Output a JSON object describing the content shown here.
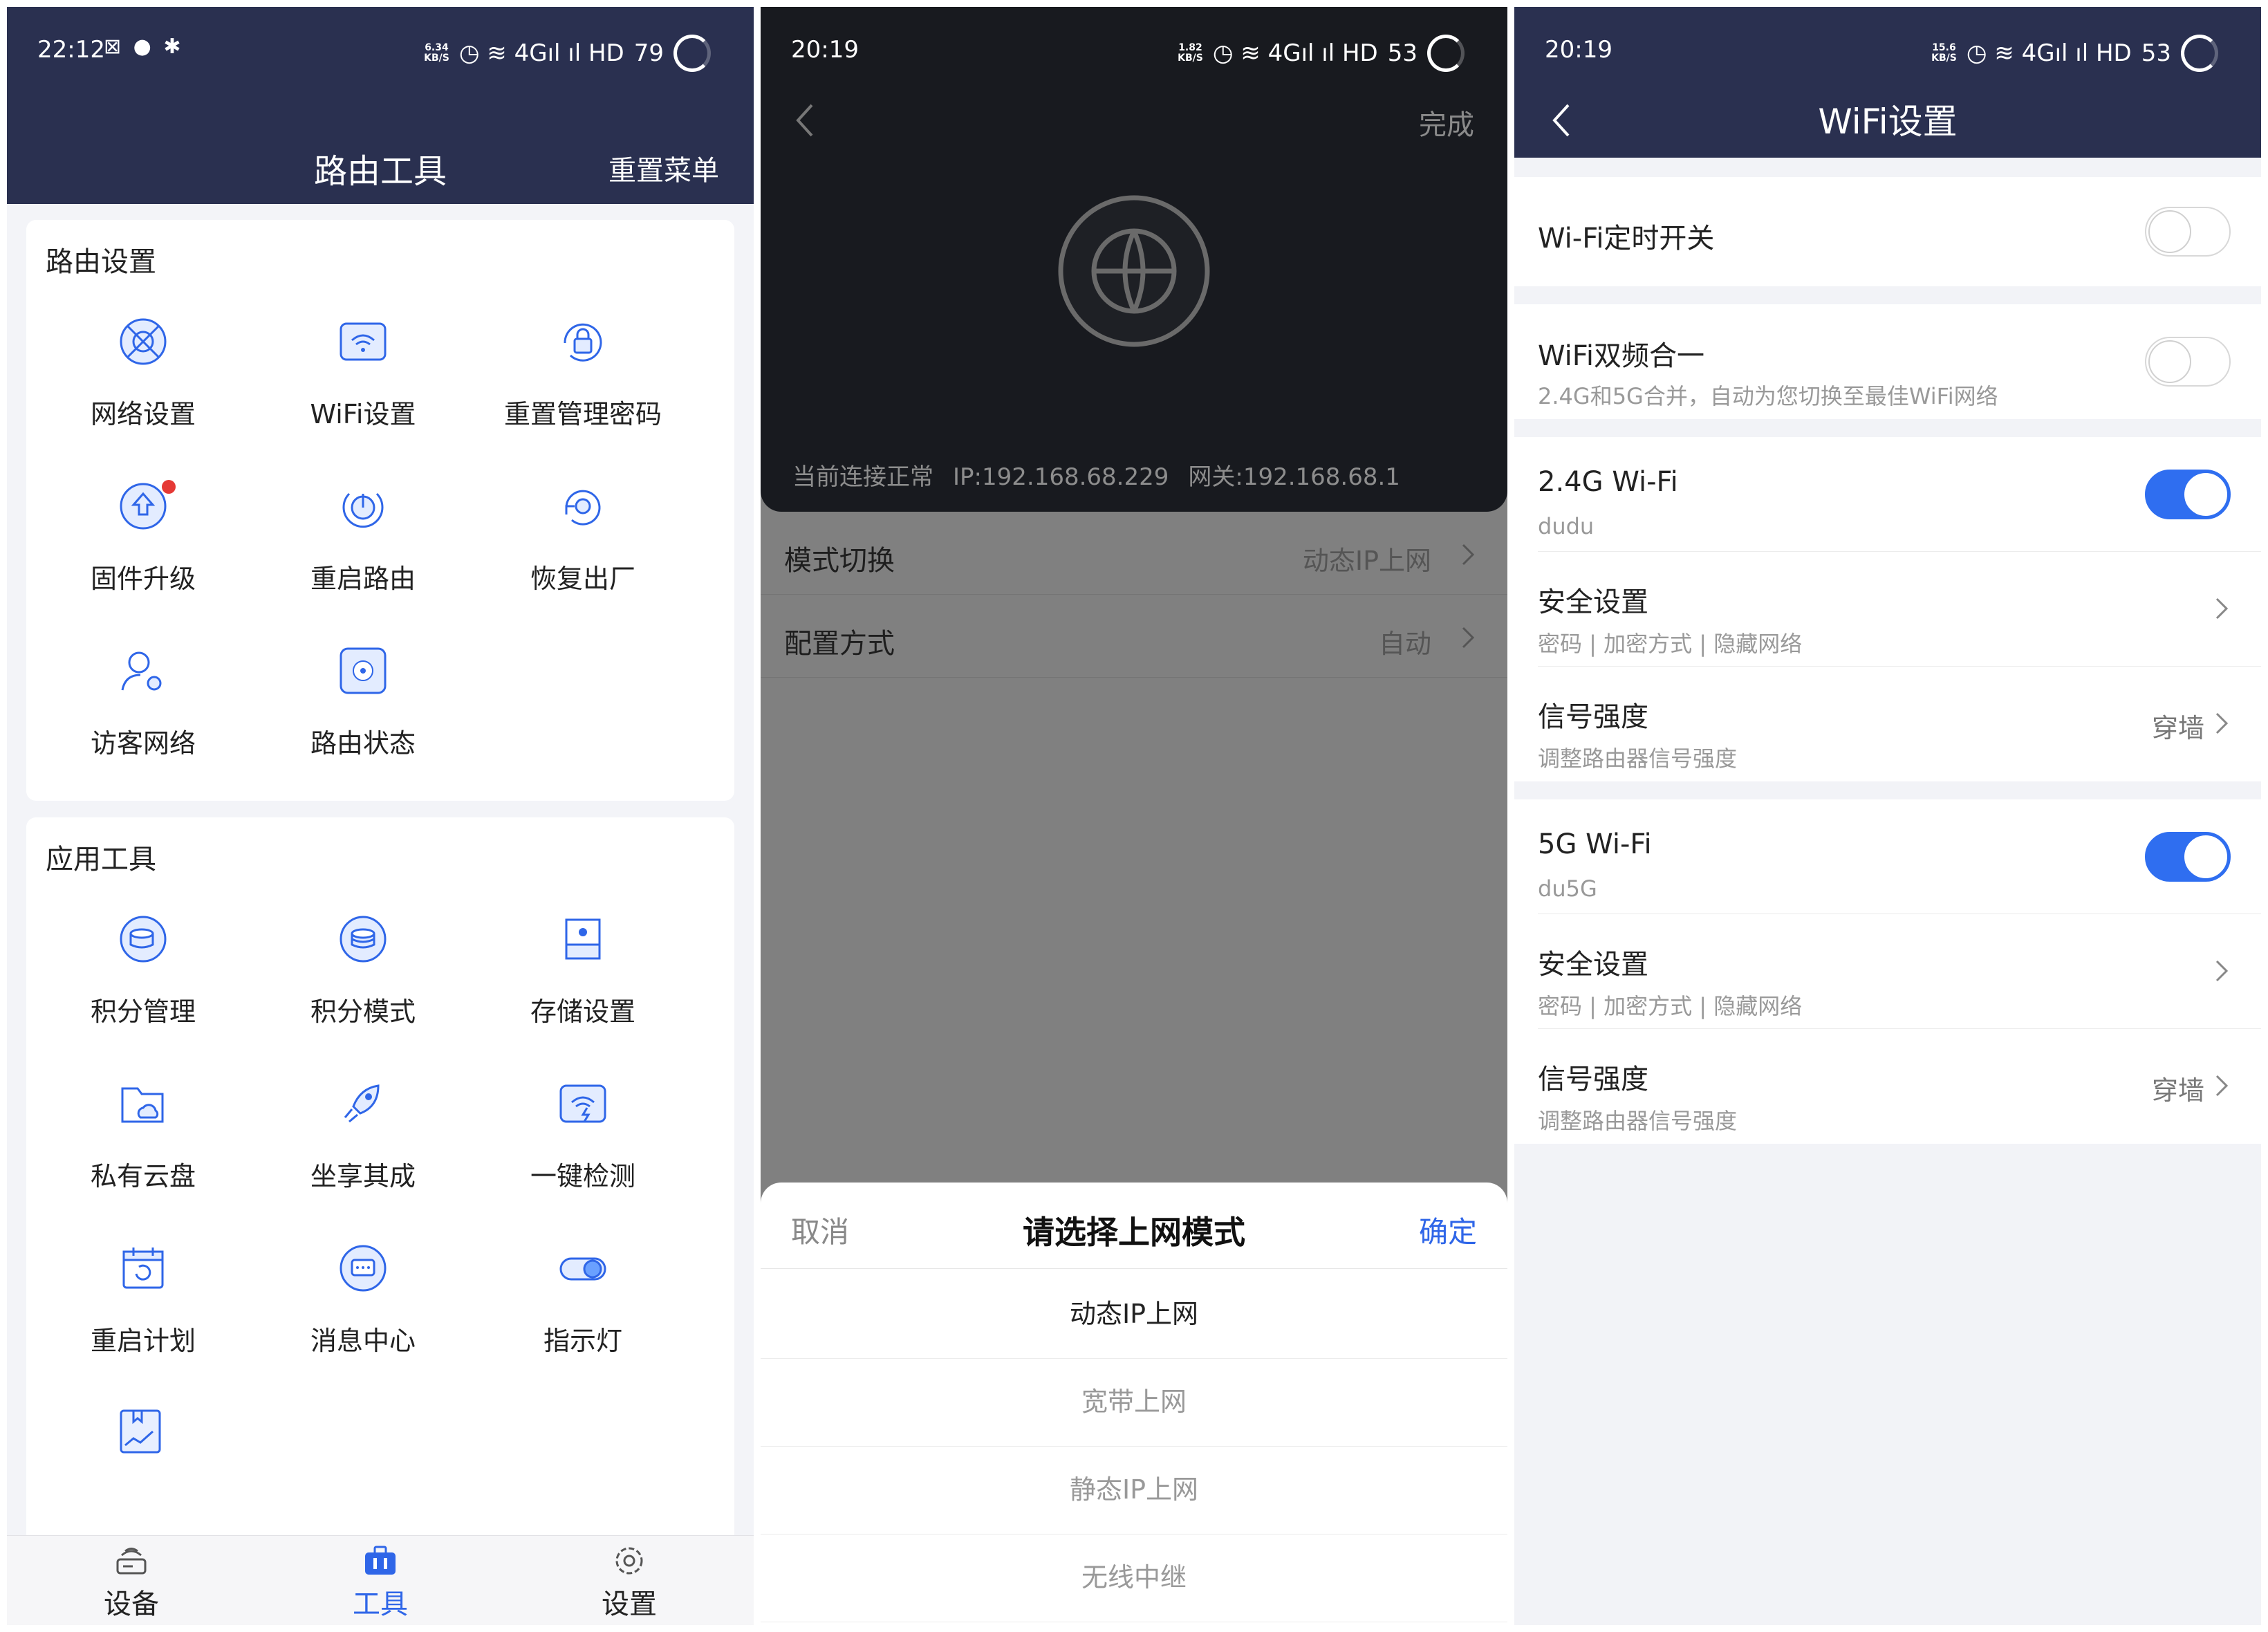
{
  "panel1": {
    "status": {
      "time": "22:12",
      "left_icons": "⊠ ● ✱",
      "speed_top": "6.34",
      "speed_bottom": "KB/S",
      "right_icons": "◷ ≋ 4Gıl ıl HD",
      "battery": "79"
    },
    "header": {
      "title": "路由工具",
      "right_action": "重置菜单"
    },
    "section_router": {
      "title": "路由设置",
      "items": [
        {
          "label": "网络设置",
          "icon": "network-icon"
        },
        {
          "label": "WiFi设置",
          "icon": "wifi-icon"
        },
        {
          "label": "重置管理密码",
          "icon": "lock-reset-icon"
        },
        {
          "label": "固件升级",
          "icon": "upgrade-icon",
          "badge": true
        },
        {
          "label": "重启路由",
          "icon": "power-icon"
        },
        {
          "label": "恢复出厂",
          "icon": "restore-icon"
        },
        {
          "label": "访客网络",
          "icon": "guest-icon"
        },
        {
          "label": "路由状态",
          "icon": "status-icon"
        }
      ]
    },
    "section_apps": {
      "title": "应用工具",
      "items": [
        {
          "label": "积分管理",
          "icon": "points-manage-icon"
        },
        {
          "label": "积分模式",
          "icon": "points-mode-icon"
        },
        {
          "label": "存储设置",
          "icon": "storage-icon"
        },
        {
          "label": "私有云盘",
          "icon": "cloud-folder-icon"
        },
        {
          "label": "坐享其成",
          "icon": "rocket-icon"
        },
        {
          "label": "一键检测",
          "icon": "check-icon"
        },
        {
          "label": "重启计划",
          "icon": "calendar-icon"
        },
        {
          "label": "消息中心",
          "icon": "message-icon"
        },
        {
          "label": "指示灯",
          "icon": "light-toggle-icon"
        }
      ]
    },
    "tabbar": [
      {
        "label": "设备",
        "icon": "router-device-icon"
      },
      {
        "label": "工具",
        "icon": "toolbox-icon",
        "active": true
      },
      {
        "label": "设置",
        "icon": "gear-icon"
      }
    ]
  },
  "panel2": {
    "status": {
      "time": "20:19",
      "speed_top": "1.82",
      "speed_bottom": "KB/S",
      "right_icons": "◷ ≋ 4Gıl ıl HD",
      "battery": "53"
    },
    "done": "完成",
    "connection": {
      "status": "当前连接正常",
      "ip": "IP:192.168.68.229",
      "gateway": "网关:192.168.68.1"
    },
    "rows": [
      {
        "label": "模式切换",
        "value": "动态IP上网"
      },
      {
        "label": "配置方式",
        "value": "自动"
      }
    ],
    "sheet": {
      "cancel": "取消",
      "title": "请选择上网模式",
      "confirm": "确定",
      "options": [
        "动态IP上网",
        "宽带上网",
        "静态IP上网",
        "无线中继"
      ],
      "selected_index": 0
    }
  },
  "panel3": {
    "status": {
      "time": "20:19",
      "speed_top": "15.6",
      "speed_bottom": "KB/S",
      "right_icons": "◷ ≋ 4Gıl ıl HD",
      "battery": "53"
    },
    "title": "WiFi设置",
    "timer": {
      "label": "Wi-Fi定时开关",
      "on": false
    },
    "dual": {
      "label": "WiFi双频合一",
      "sub": "2.4G和5G合并，自动为您切换至最佳WiFi网络",
      "on": false
    },
    "band24": {
      "label": "2.4G Wi-Fi",
      "ssid": "dudu",
      "on": true,
      "security": {
        "label": "安全设置",
        "sub": "密码 | 加密方式 | 隐藏网络"
      },
      "signal": {
        "label": "信号强度",
        "sub": "调整路由器信号强度",
        "value": "穿墙"
      }
    },
    "band5": {
      "label": "5G Wi-Fi",
      "ssid": "du5G",
      "on": true,
      "security": {
        "label": "安全设置",
        "sub": "密码 | 加密方式 | 隐藏网络"
      },
      "signal": {
        "label": "信号强度",
        "sub": "调整路由器信号强度",
        "value": "穿墙"
      }
    },
    "colors": {
      "accent": "#2f6ef0",
      "header": "#2a3050"
    }
  }
}
